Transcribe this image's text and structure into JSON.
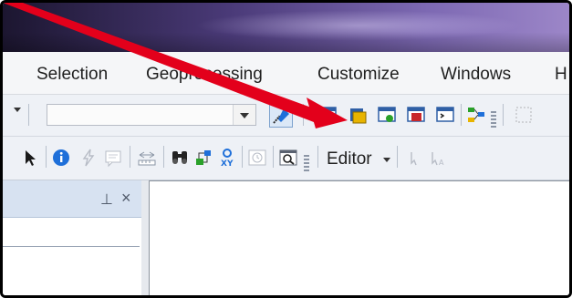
{
  "menubar": {
    "items": [
      {
        "label": "Selection"
      },
      {
        "label": "Geoprocessing"
      },
      {
        "label": "Customize"
      },
      {
        "label": "Windows"
      },
      {
        "label": "H"
      }
    ]
  },
  "toolbar_editor": {
    "editor_label": "Editor"
  },
  "toc": {
    "pin_glyph": "⊥",
    "close_glyph": "×"
  },
  "icons": {
    "toolbar1": [
      "dropdown-arrow-icon",
      "editor-toolbar-icon",
      "attribute-table-icon",
      "catalog-window-icon",
      "search-window-icon",
      "arctoolbox-icon",
      "python-window-icon",
      "model-builder-icon"
    ],
    "toolbar2": [
      "select-pointer-icon",
      "identify-icon",
      "hyperlink-icon",
      "html-popup-icon",
      "measure-icon",
      "find-icon",
      "find-route-icon",
      "go-to-xy-icon",
      "time-slider-icon",
      "magnifier-window-icon",
      "editor-dropdown-icon",
      "edit-tool-icon",
      "edit-annotation-icon"
    ]
  },
  "colors": {
    "annotation_arrow": "#e3001b",
    "title_gradient_start": "#1c1630",
    "title_gradient_end": "#9c86c8"
  }
}
